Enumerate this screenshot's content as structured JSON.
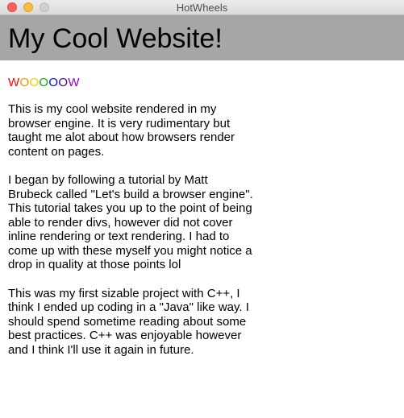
{
  "window": {
    "title": "HotWheels"
  },
  "header": {
    "title": "My Cool Website!"
  },
  "rainbow": {
    "letters": [
      {
        "char": "W",
        "color": "#ff0000"
      },
      {
        "char": "O",
        "color": "#ff8c00"
      },
      {
        "char": "O",
        "color": "#e6d200"
      },
      {
        "char": "O",
        "color": "#00b000"
      },
      {
        "char": "O",
        "color": "#0000ff"
      },
      {
        "char": "O",
        "color": "#4b0082"
      },
      {
        "char": "W",
        "color": "#9400d3"
      }
    ]
  },
  "paragraphs": [
    "This is my cool website rendered in my browser engine. It is very rudimentary but taught me alot about how browsers render content on pages.",
    "I began by following a tutorial by Matt Brubeck called \"Let's build a browser engine\". This tutorial takes you up to the point of being able to render divs, however did not cover inline rendering or text rendering. I had to come up with these myself you might notice a drop in quality at those points lol",
    "This was my first sizable project with C++, I think I ended up coding in a \"Java\" like way. I should spend sometime reading about some best practices. C++ was enjoyable however and I think I'll use it again in future."
  ]
}
